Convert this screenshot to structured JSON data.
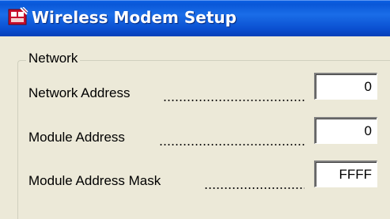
{
  "window": {
    "title": "Wireless Modem Setup",
    "icon": "app-icon"
  },
  "network_group": {
    "legend": "Network",
    "rows": [
      {
        "label": "Network Address",
        "value": "0"
      },
      {
        "label": "Module Address",
        "value": "0"
      },
      {
        "label": "Module Address Mask",
        "value": "FFFF"
      }
    ]
  }
}
